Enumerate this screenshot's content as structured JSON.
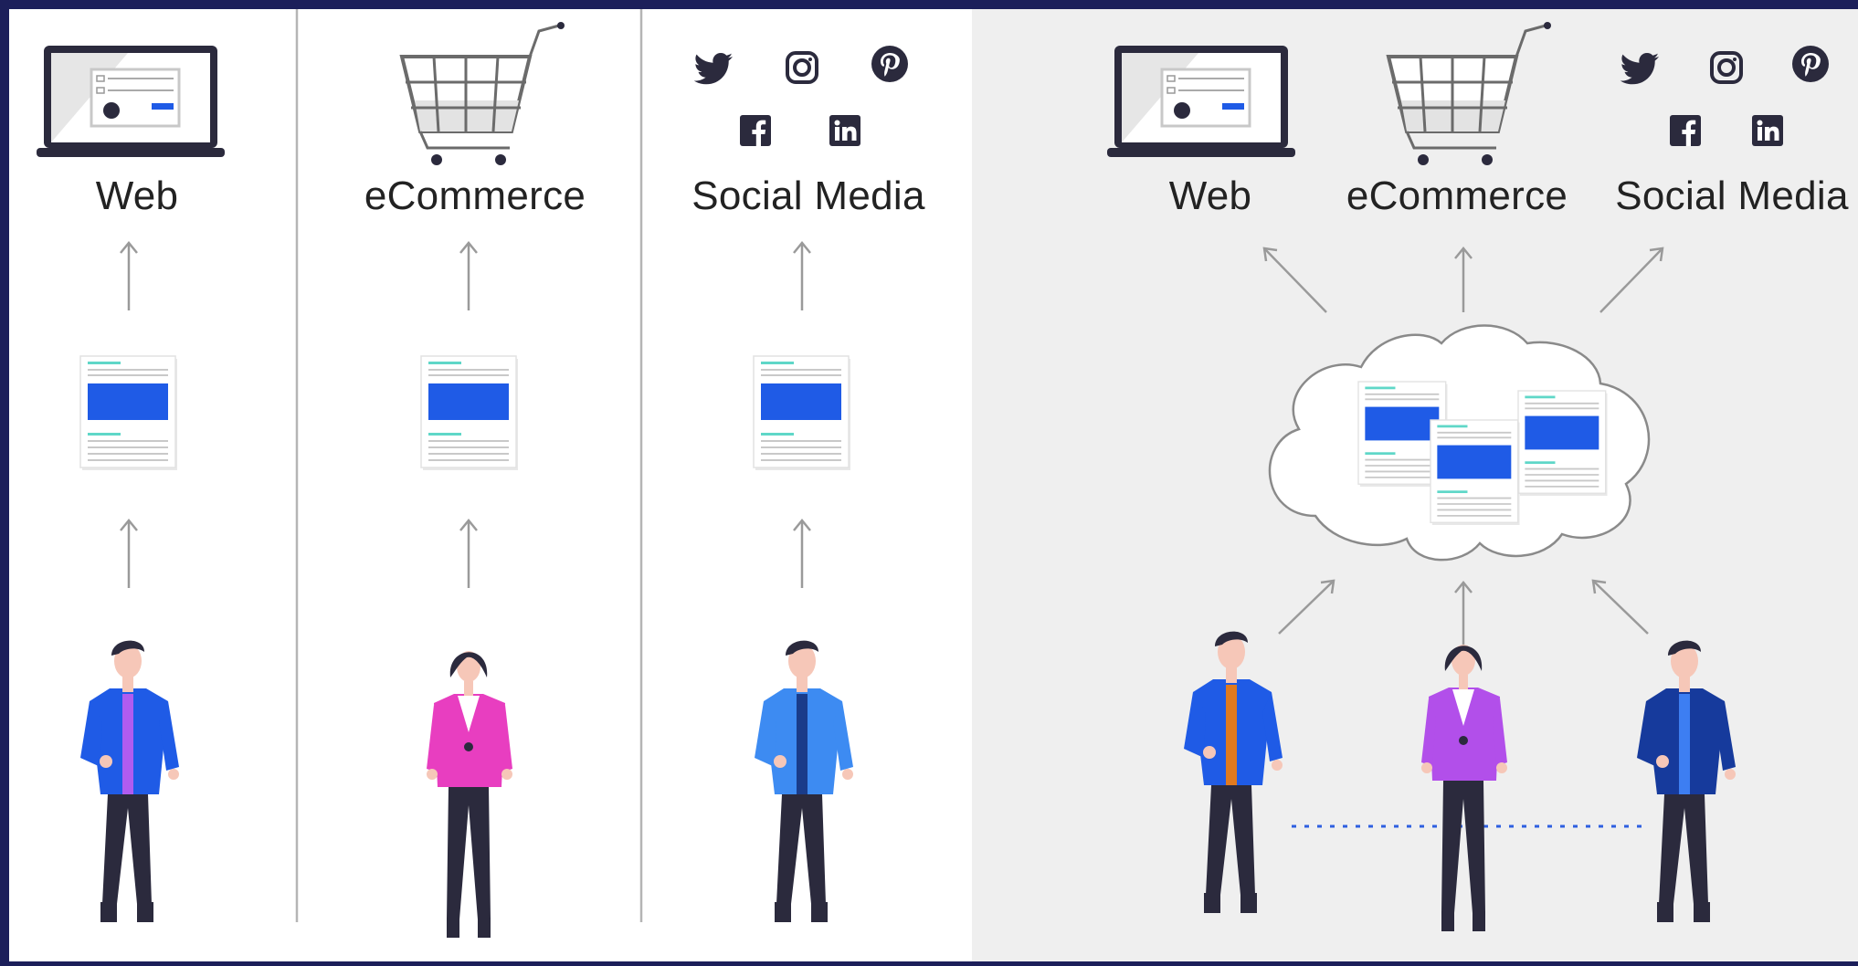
{
  "panels": {
    "left": {
      "columns": [
        {
          "label": "Web"
        },
        {
          "label": "eCommerce"
        },
        {
          "label": "Social Media"
        }
      ]
    },
    "right": {
      "labels": [
        "Web",
        "eCommerce",
        "Social Media"
      ]
    }
  },
  "colors": {
    "frame": "#1c1f5a",
    "left_background": "#ffffff",
    "right_background": "#efefef",
    "accent_block": "#1f5be6",
    "accent_line": "#5fd7c8",
    "icon_dark": "#2b2a3d",
    "person_blue": "#1f5be6",
    "person_pink": "#e83ec0",
    "person_lightblue": "#3d8bf2",
    "person_purple": "#b24fea",
    "person_navy": "#163a9c"
  },
  "icons": [
    "laptop-icon",
    "shopping-cart-icon",
    "twitter-icon",
    "instagram-icon",
    "pinterest-icon",
    "facebook-icon",
    "linkedin-icon",
    "document-icon",
    "cloud-icon",
    "person-icon"
  ]
}
